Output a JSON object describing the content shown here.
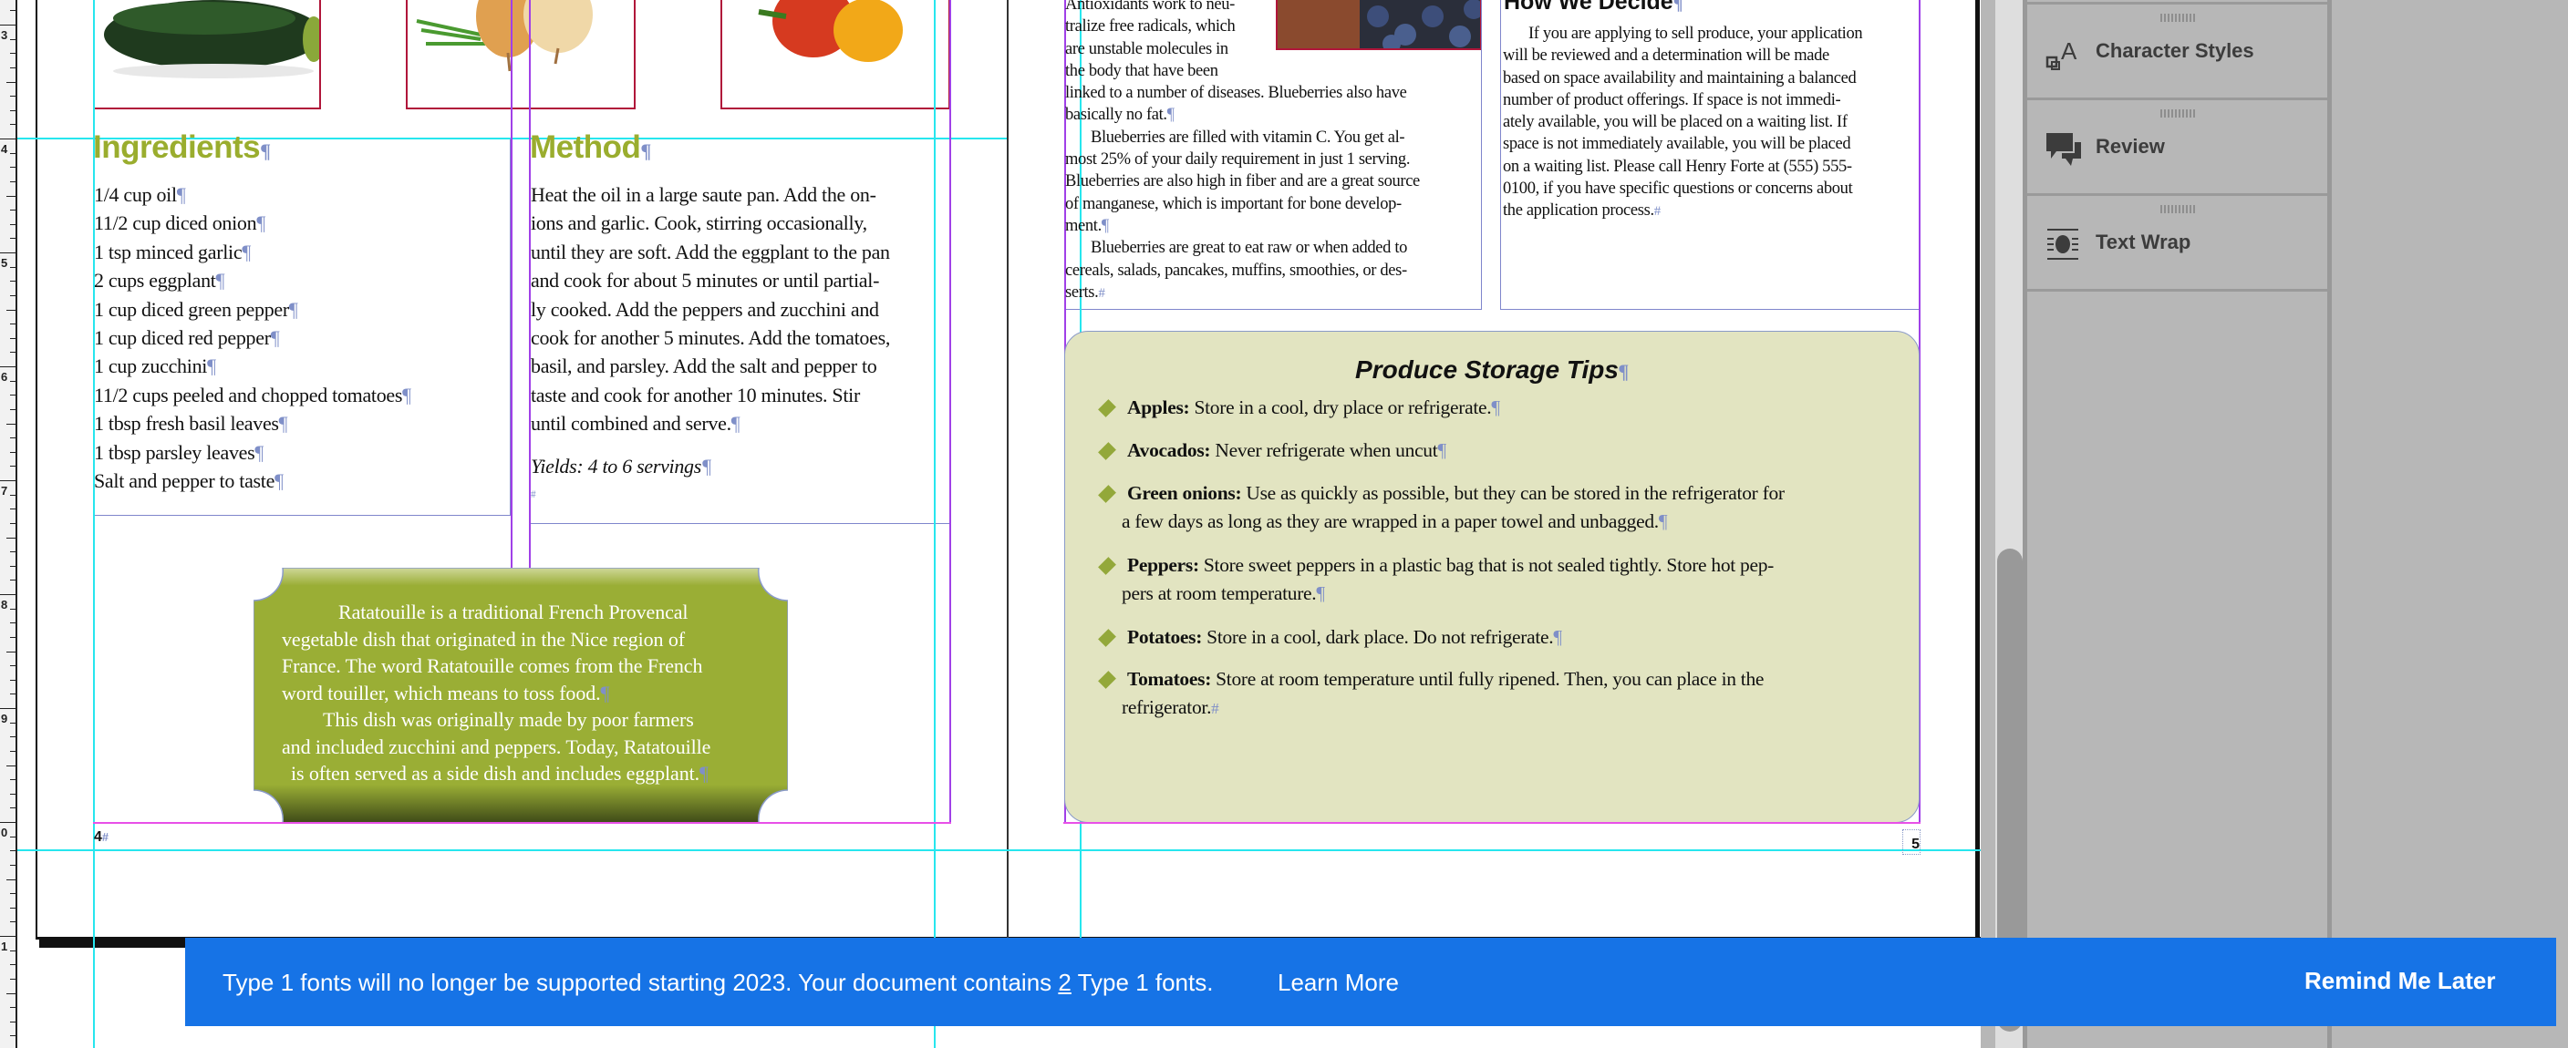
{
  "ruler": {
    "labels": [
      "3",
      "4",
      "5",
      "6",
      "7",
      "8",
      "9",
      "0",
      "1"
    ]
  },
  "left_page": {
    "page_number": "4",
    "photos": [
      "zucchini",
      "onions",
      "peppers"
    ],
    "ingredients": {
      "heading": "Ingredients",
      "items": [
        "1/4 cup oil",
        "11/2 cup diced onion",
        "1 tsp minced garlic",
        "2 cups eggplant",
        "1 cup diced green pepper",
        "1 cup diced red pepper",
        "1 cup zucchini",
        "11/2 cups peeled and chopped tomatoes",
        "1 tbsp fresh basil leaves",
        "1 tbsp parsley leaves",
        "Salt and pepper to taste"
      ]
    },
    "method": {
      "heading": "Method",
      "lines": [
        "Heat the oil in a large saute pan. Add the on-",
        "ions and garlic. Cook, stirring occasionally,",
        "until they are soft. Add the eggplant to the pan",
        "and cook for about 5 minutes or until partial-",
        "ly cooked. Add the peppers and zucchini and",
        "cook for another 5 minutes. Add the tomatoes,",
        "basil, and parsley. Add the salt and pepper to",
        "taste and cook for another 10 minutes. Stir",
        "until combined and serve."
      ],
      "yields": "Yields: 4 to 6 servings"
    },
    "ratatouille_box": {
      "lines": [
        "Ratatouille is a traditional French Provencal",
        "vegetable dish that originated in the Nice region of",
        "France. The word Ratatouille comes from the French",
        "word touiller, which means to toss food.",
        "This dish was originally made by poor farmers",
        "and included zucchini and peppers. Today, Ratatouille",
        "is often served as a side dish and includes eggplant."
      ],
      "bg_color": "#9aae35"
    }
  },
  "right_page": {
    "page_number": "5",
    "blueberries": {
      "lines": [
        "Antioxidants work to neu-",
        "tralize free radicals, which",
        "are unstable molecules in",
        "the body that have been",
        "linked to a number of diseases. Blueberries also have",
        "basically no fat.",
        "Blueberries are filled with vitamin C. You get al-",
        "most 25% of your daily requirement in just 1 serving.",
        "Blueberries are also high in fiber and are a great source",
        "of manganese, which is important for bone develop-",
        "ment.",
        "Blueberries are great to eat raw or when added to",
        "cereals, salads, pancakes, muffins, smoothies, or des-",
        "serts."
      ]
    },
    "how_we_decide": {
      "heading": "How We Decide",
      "lines": [
        "If you are applying to sell produce, your application",
        "will be reviewed and a determination will be made",
        "based on space availability and maintaining a balanced",
        "number of product offerings. If space is not immedi-",
        "ately available, you will be placed on a waiting list. If",
        "space is not immediately available, you will be placed",
        "on a waiting list. Please call Henry Forte at (555) 555-",
        "0100, if you have specific questions or concerns about",
        "the application process."
      ]
    },
    "storage_tips": {
      "title": "Produce Storage Tips",
      "bg_color": "#e2e4c1",
      "items": [
        {
          "label": "Apples:",
          "lines": [
            "Store in a cool, dry place or refrigerate."
          ]
        },
        {
          "label": "Avocados:",
          "lines": [
            "Never refrigerate when uncut"
          ]
        },
        {
          "label": "Green onions:",
          "lines": [
            "Use as quickly as possible, but they can be stored in the refrigerator for",
            "a few days as long as they are wrapped in a paper towel and unbagged."
          ]
        },
        {
          "label": "Peppers:",
          "lines": [
            "Store sweet peppers in a plastic bag that is not sealed tightly. Store hot pep-",
            "pers at room temperature."
          ]
        },
        {
          "label": "Potatoes:",
          "lines": [
            "Store in a cool, dark place. Do not refrigerate."
          ]
        },
        {
          "label": "Tomatoes:",
          "lines": [
            "Store at room temperature until fully ripened. Then, you can place in the",
            "refrigerator."
          ]
        }
      ]
    }
  },
  "panel": {
    "items": [
      {
        "label": "Character Styles",
        "icon": "character-styles-icon"
      },
      {
        "label": "Review",
        "icon": "review-icon"
      },
      {
        "label": "Text Wrap",
        "icon": "text-wrap-icon"
      }
    ]
  },
  "banner": {
    "message_before": "Type 1 fonts will no longer be supported starting 2023. Your document contains ",
    "count": "2",
    "message_after": " Type 1 fonts.",
    "learn_more": "Learn More",
    "remind_later": "Remind Me Later",
    "color": "#1673e6"
  }
}
